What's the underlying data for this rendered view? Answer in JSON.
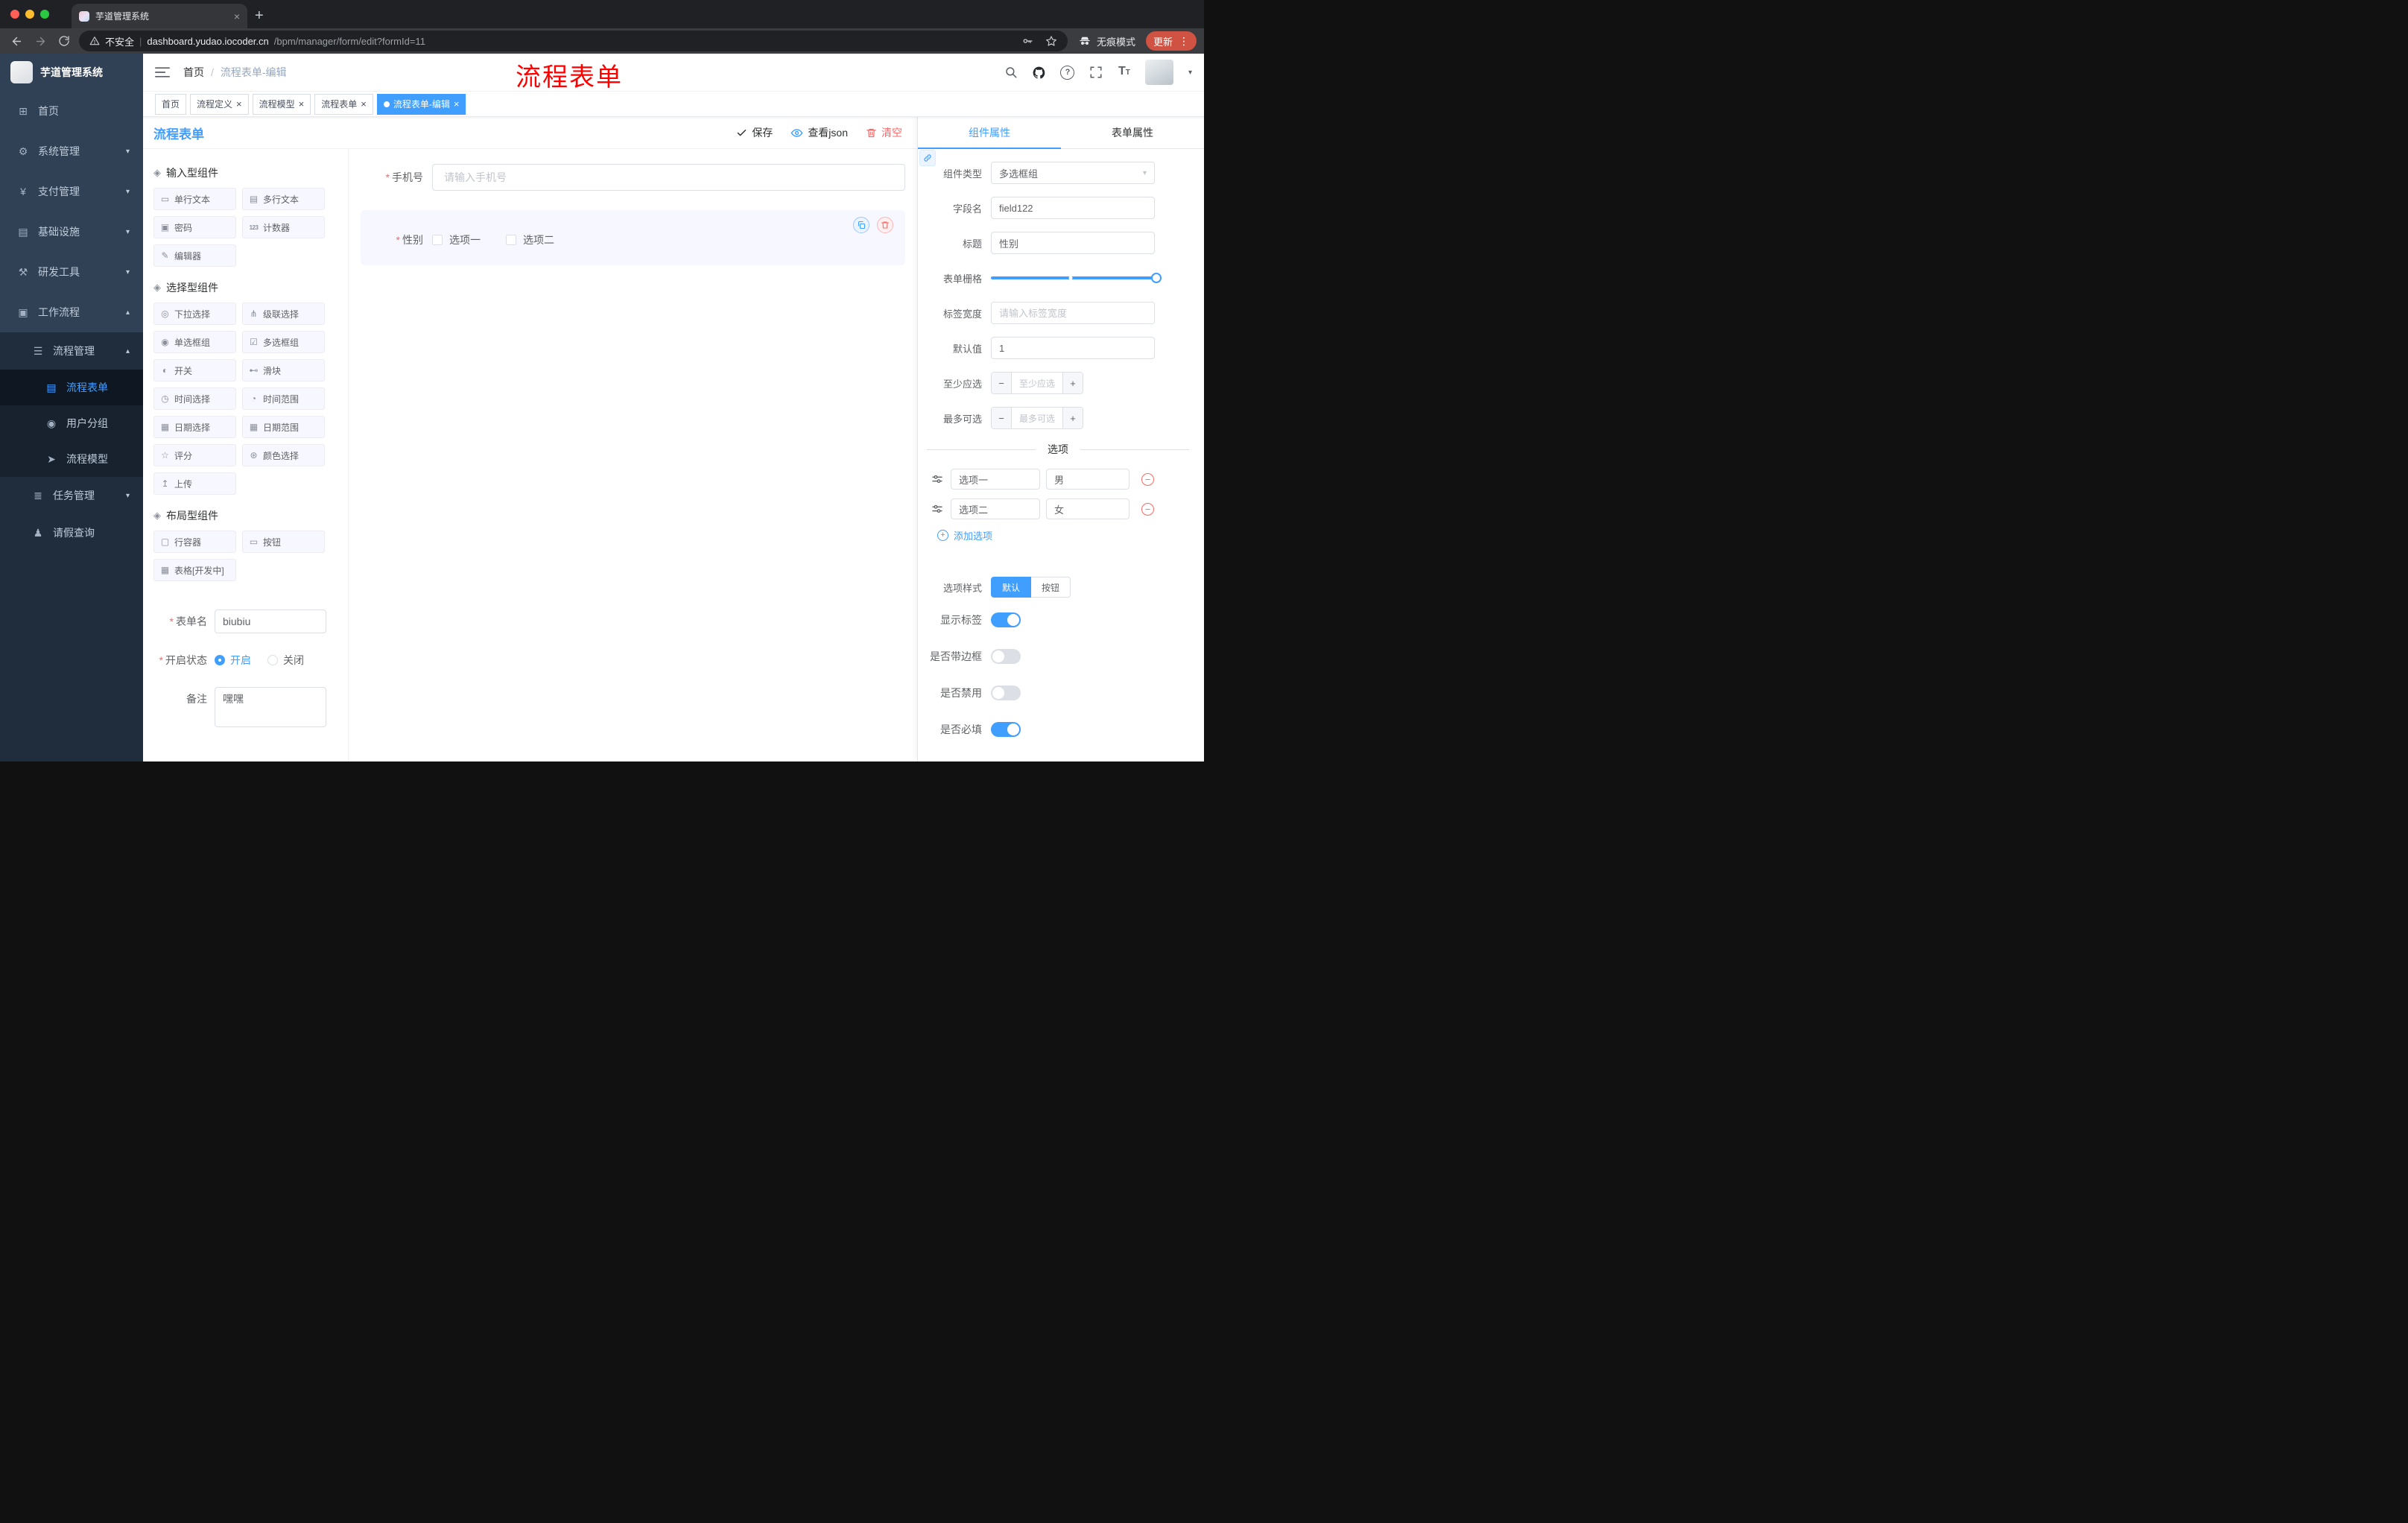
{
  "colors": {
    "accent": "#409eff",
    "danger": "#f56c6c",
    "sidebar_bg": "#304156",
    "submenu_bg": "#1f2d3d",
    "active_tag_bg": "#409eff",
    "update_button_bg": "#cf5242",
    "annotation_red": "#fe0000",
    "selected_field_bg": "#f6f7ff"
  },
  "glyphs": {
    "close": "×",
    "minus": "−",
    "plus": "+",
    "chevron_down": "▾",
    "chevron_up": "▴",
    "kebab": "⋮",
    "slash": "/",
    "pipe": "|",
    "question": "?",
    "font_size_big": "T",
    "font_size_small": "T"
  },
  "browser": {
    "tab_title": "芋道管理系统",
    "security_label": "不安全",
    "url_host": "dashboard.yudao.iocoder.cn",
    "url_path": "/bpm/manager/form/edit?formId=11",
    "incognito_label": "无痕模式",
    "update_label": "更新"
  },
  "sidebar": {
    "logo_title": "芋道管理系统",
    "items": [
      {
        "label": "首页",
        "level": 1,
        "icon": "home-icon",
        "glyph": "⊞"
      },
      {
        "label": "系统管理",
        "level": 1,
        "icon": "gear-icon",
        "glyph": "⚙",
        "chevron": "down"
      },
      {
        "label": "支付管理",
        "level": 1,
        "icon": "payment-icon",
        "glyph": "¥",
        "chevron": "down"
      },
      {
        "label": "基础设施",
        "level": 1,
        "icon": "infrastructure-icon",
        "glyph": "▤",
        "chevron": "down"
      },
      {
        "label": "研发工具",
        "level": 1,
        "icon": "devtools-icon",
        "glyph": "⚒",
        "chevron": "down"
      },
      {
        "label": "工作流程",
        "level": 1,
        "icon": "workflow-icon",
        "glyph": "▣",
        "chevron": "up"
      },
      {
        "label": "流程管理",
        "level": 2,
        "icon": "process-management-icon",
        "glyph": "☰",
        "chevron": "up"
      },
      {
        "label": "流程表单",
        "level": 3,
        "icon": "process-form-icon",
        "glyph": "▤",
        "active": true
      },
      {
        "label": "用户分组",
        "level": 3,
        "icon": "user-group-icon",
        "glyph": "◉"
      },
      {
        "label": "流程模型",
        "level": 3,
        "icon": "process-model-icon",
        "glyph": "➤"
      },
      {
        "label": "任务管理",
        "level": 2,
        "icon": "task-management-icon",
        "glyph": "≣",
        "chevron": "down"
      },
      {
        "label": "请假查询",
        "level": 2,
        "icon": "leave-query-icon",
        "glyph": "♟"
      }
    ]
  },
  "header": {
    "breadcrumb": [
      "首页",
      "流程表单-编辑"
    ],
    "annotation": "流程表单"
  },
  "tags": [
    {
      "label": "首页",
      "closable": false,
      "active": false
    },
    {
      "label": "流程定义",
      "closable": true,
      "active": false
    },
    {
      "label": "流程模型",
      "closable": true,
      "active": false
    },
    {
      "label": "流程表单",
      "closable": true,
      "active": false
    },
    {
      "label": "流程表单-编辑",
      "closable": true,
      "active": true
    }
  ],
  "designer": {
    "title": "流程表单",
    "actions": {
      "save": "保存",
      "view_json": "查看json",
      "clear": "清空"
    },
    "palette": {
      "groups": [
        {
          "title": "输入型组件",
          "glyph": "◈",
          "items": [
            {
              "label": "单行文本",
              "icon": "single-line-text-icon",
              "glyph": "▭"
            },
            {
              "label": "多行文本",
              "icon": "multi-line-text-icon",
              "glyph": "▤"
            },
            {
              "label": "密码",
              "icon": "password-icon",
              "glyph": "▣"
            },
            {
              "label": "计数器",
              "icon": "counter-icon",
              "glyph": "123"
            },
            {
              "label": "编辑器",
              "icon": "editor-icon",
              "glyph": "✎"
            }
          ]
        },
        {
          "title": "选择型组件",
          "glyph": "◈",
          "items": [
            {
              "label": "下拉选择",
              "icon": "select-icon",
              "glyph": "◎"
            },
            {
              "label": "级联选择",
              "icon": "cascader-icon",
              "glyph": "⋔"
            },
            {
              "label": "单选框组",
              "icon": "radio-group-icon",
              "glyph": "◉"
            },
            {
              "label": "多选框组",
              "icon": "checkbox-group-icon",
              "glyph": "☑"
            },
            {
              "label": "开关",
              "icon": "switch-icon",
              "glyph": "◐"
            },
            {
              "label": "滑块",
              "icon": "slider-icon",
              "glyph": "⊷"
            },
            {
              "label": "时间选择",
              "icon": "time-picker-icon",
              "glyph": "◷"
            },
            {
              "label": "时间范围",
              "icon": "time-range-icon",
              "glyph": "◔"
            },
            {
              "label": "日期选择",
              "icon": "date-picker-icon",
              "glyph": "▦"
            },
            {
              "label": "日期范围",
              "icon": "date-range-icon",
              "glyph": "▦"
            },
            {
              "label": "评分",
              "icon": "rate-icon",
              "glyph": "☆"
            },
            {
              "label": "颜色选择",
              "icon": "color-picker-icon",
              "glyph": "⊛"
            },
            {
              "label": "上传",
              "icon": "upload-icon",
              "glyph": "↥"
            }
          ]
        },
        {
          "title": "布局型组件",
          "glyph": "◈",
          "items": [
            {
              "label": "行容器",
              "icon": "row-container-icon",
              "glyph": "▢"
            },
            {
              "label": "按钮",
              "icon": "button-icon",
              "glyph": "▭"
            },
            {
              "label": "表格[开发中]",
              "icon": "table-icon",
              "glyph": "▦"
            }
          ]
        }
      ]
    },
    "meta": {
      "form_name": {
        "label": "表单名",
        "required": true,
        "value": "biubiu"
      },
      "status": {
        "label": "开启状态",
        "required": true,
        "options": [
          {
            "label": "开启",
            "checked": true
          },
          {
            "label": "关闭",
            "checked": false
          }
        ]
      },
      "remark": {
        "label": "备注",
        "value": "嘿嘿"
      }
    },
    "canvas": {
      "fields": [
        {
          "label": "手机号",
          "required": true,
          "type": "input",
          "placeholder": "请输入手机号"
        },
        {
          "label": "性别",
          "required": true,
          "type": "checkbox-group",
          "options": [
            "选项一",
            "选项二"
          ],
          "selected": true
        }
      ]
    }
  },
  "panel": {
    "tabs": [
      {
        "label": "组件属性",
        "active": true
      },
      {
        "label": "表单属性",
        "active": false
      }
    ],
    "component_type": {
      "label": "组件类型",
      "value": "多选框组"
    },
    "field_name": {
      "label": "字段名",
      "value": "field122"
    },
    "title": {
      "label": "标题",
      "value": "性别"
    },
    "grid": {
      "label": "表单栅格"
    },
    "label_width": {
      "label": "标签宽度",
      "placeholder": "请输入标签宽度"
    },
    "default_value": {
      "label": "默认值",
      "value": "1"
    },
    "min_select": {
      "label": "至少应选",
      "placeholder": "至少应选"
    },
    "max_select": {
      "label": "最多可选",
      "placeholder": "最多可选"
    },
    "options_divider": "选项",
    "options": [
      {
        "label": "选项一",
        "value": "男"
      },
      {
        "label": "选项二",
        "value": "女"
      }
    ],
    "add_option": "添加选项",
    "option_style": {
      "label": "选项样式",
      "options": [
        {
          "label": "默认",
          "active": true
        },
        {
          "label": "按钮",
          "active": false
        }
      ]
    },
    "switches": [
      {
        "label": "显示标签",
        "on": true,
        "name": "show-label"
      },
      {
        "label": "是否带边框",
        "on": false,
        "name": "with-border"
      },
      {
        "label": "是否禁用",
        "on": false,
        "name": "is-disabled"
      },
      {
        "label": "是否必填",
        "on": true,
        "name": "is-required"
      }
    ]
  }
}
